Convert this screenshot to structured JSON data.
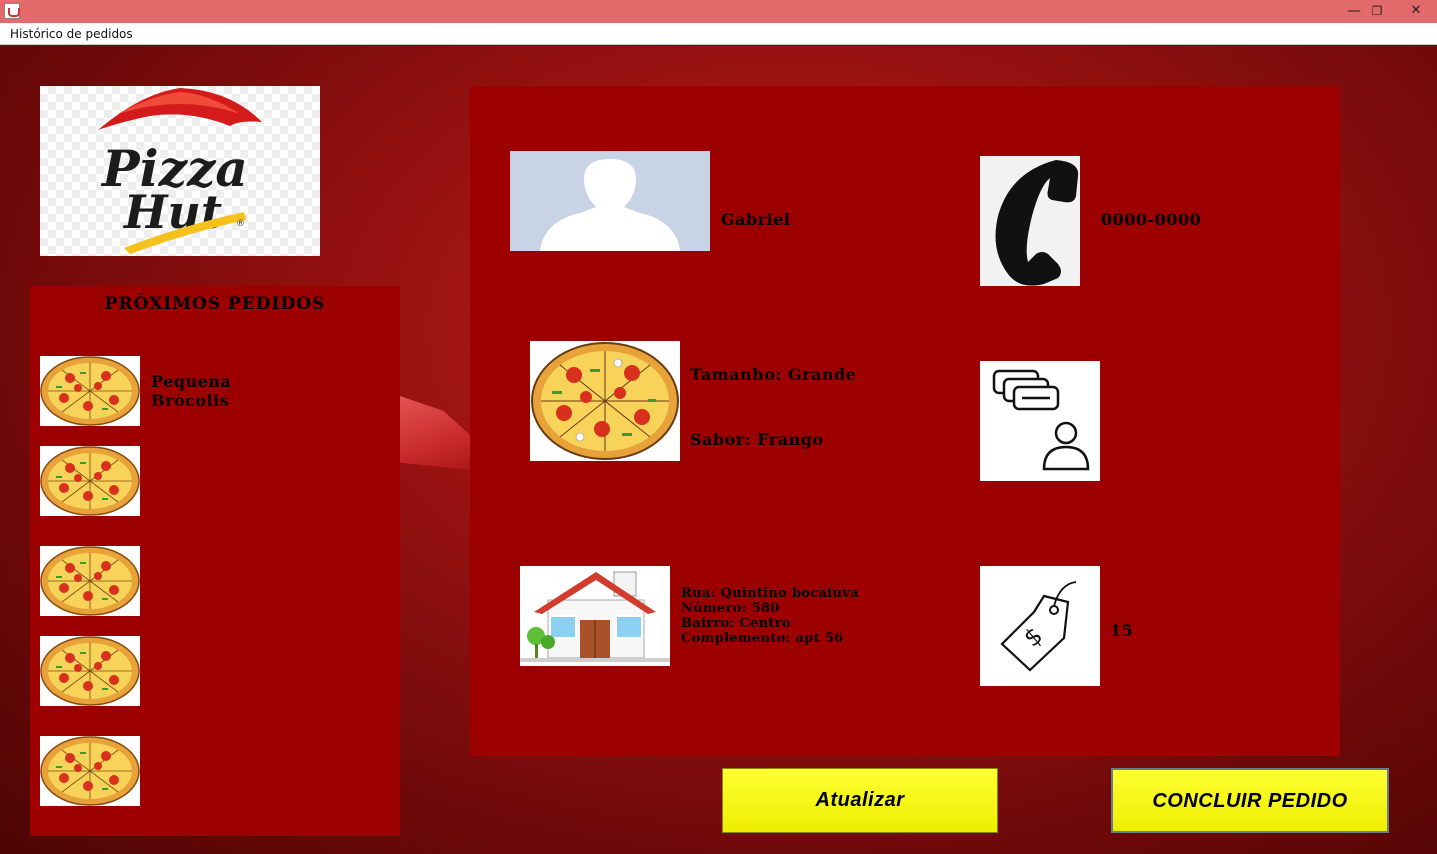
{
  "window": {
    "minimize_glyph": "—",
    "maximize_glyph": "❐",
    "close_glyph": "✕"
  },
  "menu": {
    "items": [
      {
        "label": "Histórico de pedidos"
      }
    ]
  },
  "logo": {
    "brand_line1": "Pizza",
    "brand_line2": "Hut",
    "registered_mark": "®"
  },
  "queue": {
    "title": "PRÓXIMOS PEDIDOS",
    "orders": [
      {
        "size": "Pequena",
        "flavor": "Brocolis"
      },
      {
        "size": "",
        "flavor": ""
      },
      {
        "size": "",
        "flavor": ""
      },
      {
        "size": "",
        "flavor": ""
      },
      {
        "size": "",
        "flavor": ""
      }
    ]
  },
  "order": {
    "customer_name": "Gabriel",
    "phone": "0000-0000",
    "size_text": "Tamanho: Grande",
    "flavor_text": "Sabor: Frango",
    "address": {
      "street": "Rua: Quintino bocaiuva",
      "number": "Número: 580",
      "district": "Bairro: Centro",
      "complement": "Complemento: apt 56"
    },
    "observations": "",
    "price": "15",
    "price_tag_symbol": "$"
  },
  "buttons": {
    "refresh": "Atualizar",
    "finish": "CONCLUIR PEDIDO"
  },
  "colors": {
    "panel": "#9c0000",
    "button": "#ffff22",
    "titlebar": "#e26a6a"
  }
}
